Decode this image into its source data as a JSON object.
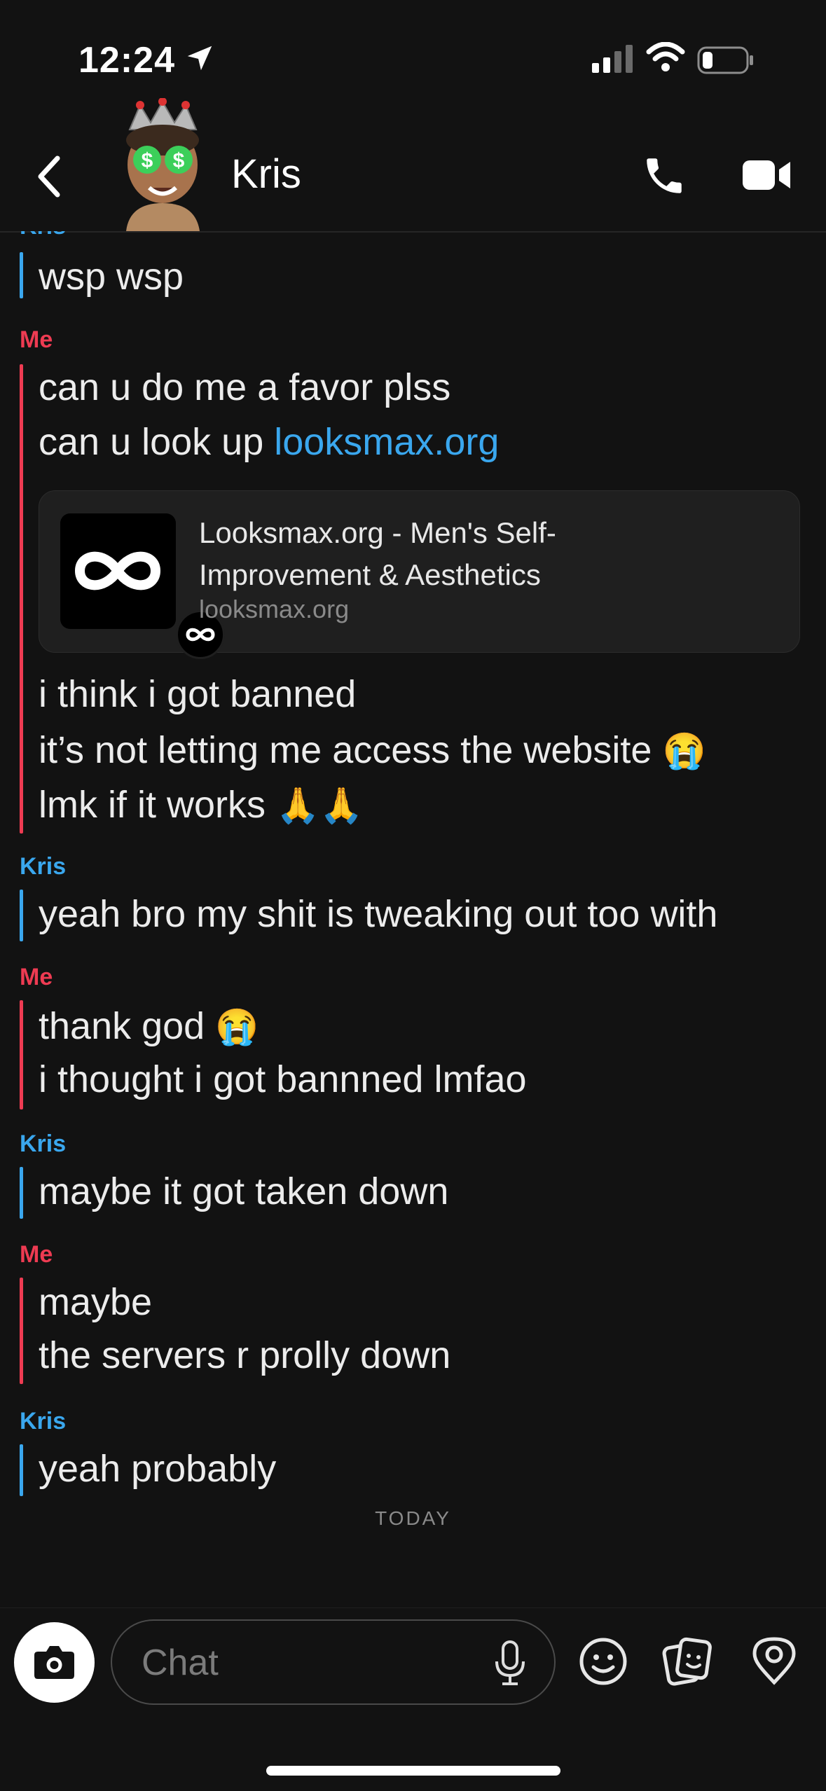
{
  "status_bar": {
    "time": "12:24"
  },
  "header": {
    "contact_name": "Kris"
  },
  "messages": [
    {
      "sender": "Kris",
      "lines": [
        "wsp wsp"
      ]
    },
    {
      "sender": "Me",
      "lines": [
        "can u do me a favor plss"
      ],
      "line2_prefix": "can u look up ",
      "line2_link": "looksmax.org",
      "link_card": {
        "title": "Looksmax.org - Men's Self-Improvement & Aesthetics",
        "url": "looksmax.org"
      },
      "after_lines": [
        "i think i got banned",
        "it’s not letting me access the website",
        "lmk if it works"
      ],
      "emojis": {
        "crying": "😭",
        "pray": "🙏🙏"
      }
    },
    {
      "sender": "Kris",
      "lines": [
        "yeah bro my shit is tweaking out too with"
      ]
    },
    {
      "sender": "Me",
      "lines": [
        "thank god",
        "i thought i got bannned lmfao"
      ]
    },
    {
      "sender": "Kris",
      "lines": [
        "maybe it got taken down"
      ]
    },
    {
      "sender": "Me",
      "lines": [
        "maybe",
        "the servers r prolly down"
      ]
    },
    {
      "sender": "Kris",
      "lines": [
        "yeah probably"
      ]
    }
  ],
  "labels": {
    "kris": "Kris",
    "me": "Me",
    "today": "TODAY"
  },
  "composer": {
    "placeholder": "Chat"
  },
  "icons": [
    "location-arrow-icon",
    "signal-icon",
    "wifi-icon",
    "battery-icon",
    "back-icon",
    "phone-icon",
    "video-icon",
    "camera-icon",
    "mic-icon",
    "smiley-icon",
    "sticker-icon",
    "location-pin-icon"
  ],
  "colors": {
    "kris": "#3aa7ee",
    "me": "#ee3b52",
    "link": "#3aa7ee",
    "background": "#121212"
  }
}
